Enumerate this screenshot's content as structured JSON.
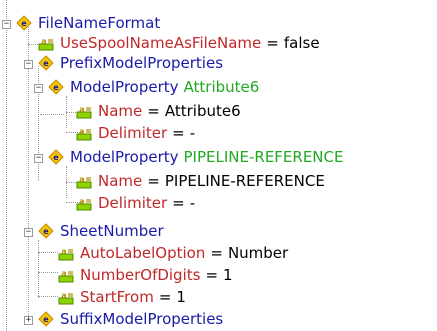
{
  "tree": {
    "root": {
      "label": "FileNameFormat",
      "expander": "−"
    },
    "items": [
      {
        "kind": "attr",
        "name": "UseSpoolNameAsFileName",
        "eq": "=",
        "value": "false"
      },
      {
        "kind": "element",
        "name": "PrefixModelProperties",
        "expander": "−"
      },
      {
        "kind": "element",
        "name": "ModelProperty",
        "id": "Attribute6",
        "expander": "−"
      },
      {
        "kind": "attr",
        "name": "Name",
        "eq": "=",
        "value": "Attribute6"
      },
      {
        "kind": "attr",
        "name": "Delimiter",
        "eq": "=",
        "value": "-"
      },
      {
        "kind": "element",
        "name": "ModelProperty",
        "id": "PIPELINE-REFERENCE",
        "expander": "−"
      },
      {
        "kind": "attr",
        "name": "Name",
        "eq": "=",
        "value": "PIPELINE-REFERENCE"
      },
      {
        "kind": "attr",
        "name": "Delimiter",
        "eq": "=",
        "value": "-"
      },
      {
        "kind": "element",
        "name": "SheetNumber",
        "expander": "−"
      },
      {
        "kind": "attr",
        "name": "AutoLabelOption",
        "eq": "=",
        "value": "Number"
      },
      {
        "kind": "attr",
        "name": "NumberOfDigits",
        "eq": "=",
        "value": "1"
      },
      {
        "kind": "attr",
        "name": "StartFrom",
        "eq": "=",
        "value": "1"
      },
      {
        "kind": "element",
        "name": "SuffixModelProperties",
        "expander": "+"
      }
    ]
  },
  "icons": {
    "element": "xml-element-icon",
    "attribute": "xml-attribute-icon"
  },
  "colors": {
    "element_label": "#1a1aa8",
    "attribute_label": "#c0282a",
    "id_label": "#22a822",
    "value_text": "#000000",
    "tree_lines": "#9a9a9a"
  }
}
